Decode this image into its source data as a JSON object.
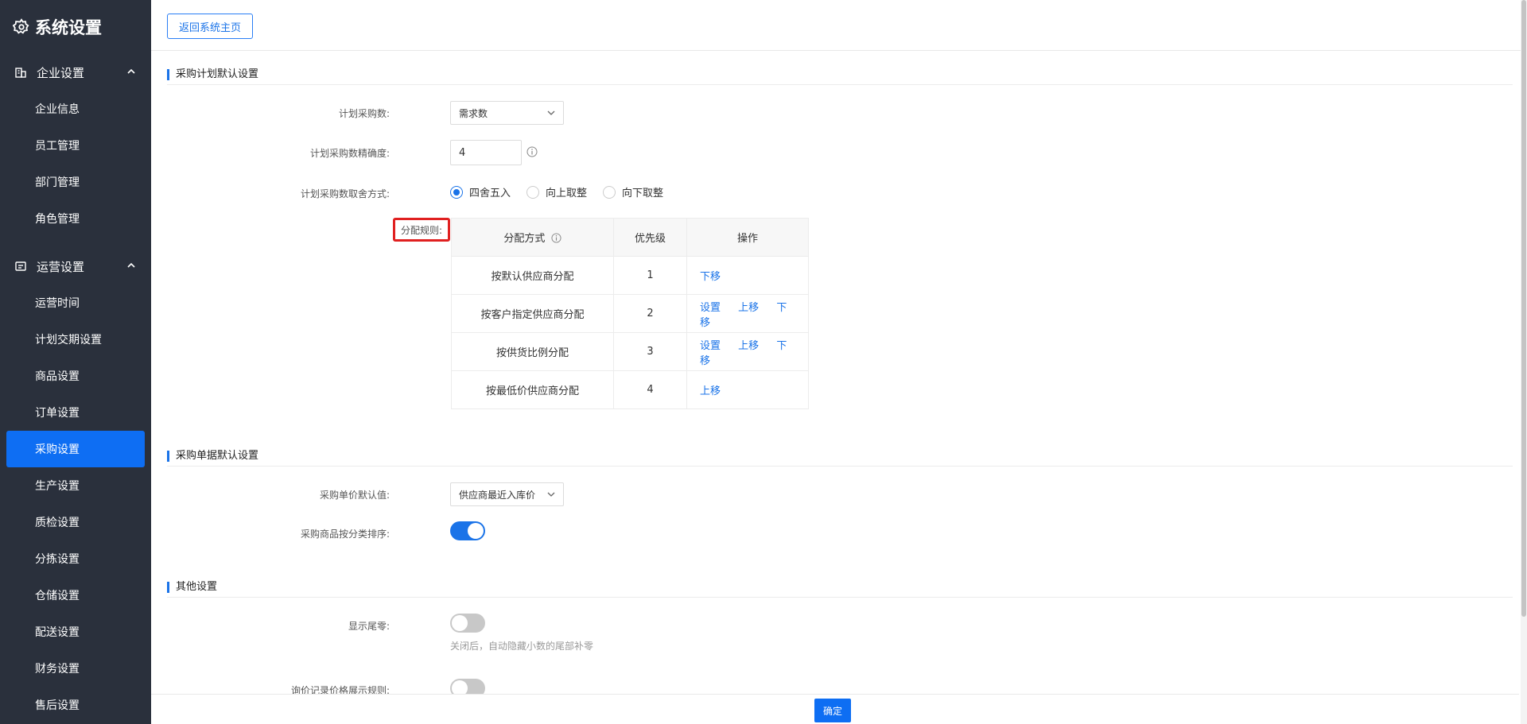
{
  "sidebar": {
    "title": "系统设置",
    "groups": [
      {
        "label": "企业设置",
        "items": [
          "企业信息",
          "员工管理",
          "部门管理",
          "角色管理"
        ]
      },
      {
        "label": "运营设置",
        "items": [
          "运营时间",
          "计划交期设置",
          "商品设置",
          "订单设置",
          "采购设置",
          "生产设置",
          "质检设置",
          "分拣设置",
          "仓储设置",
          "配送设置",
          "财务设置",
          "售后设置"
        ]
      }
    ],
    "active_item": "采购设置"
  },
  "topbar": {
    "back_label": "返回系统主页"
  },
  "section1": {
    "title": "采购计划默认设置",
    "plan_qty": {
      "label": "计划采购数:",
      "value": "需求数"
    },
    "precision": {
      "label": "计划采购数精确度:",
      "value": "4"
    },
    "rounding": {
      "label": "计划采购数取舍方式:",
      "options": [
        "四舍五入",
        "向上取整",
        "向下取整"
      ],
      "selected": "四舍五入"
    },
    "rules": {
      "label": "分配规则:",
      "headers": [
        "分配方式",
        "优先级",
        "操作"
      ],
      "rows": [
        {
          "method": "按默认供应商分配",
          "priority": "1",
          "ops": [
            "下移"
          ]
        },
        {
          "method": "按客户指定供应商分配",
          "priority": "2",
          "ops": [
            "设置",
            "上移",
            "下移"
          ]
        },
        {
          "method": "按供货比例分配",
          "priority": "3",
          "ops": [
            "设置",
            "上移",
            "下移"
          ]
        },
        {
          "method": "按最低价供应商分配",
          "priority": "4",
          "ops": [
            "上移"
          ]
        }
      ]
    }
  },
  "section2": {
    "title": "采购单据默认设置",
    "unit_price": {
      "label": "采购单价默认值:",
      "value": "供应商最近入库价"
    },
    "sort_by_category": {
      "label": "采购商品按分类排序:",
      "on": true
    }
  },
  "section3": {
    "title": "其他设置",
    "show_trailing_zero": {
      "label": "显示尾零:",
      "on": false,
      "hint": "关闭后，自动隐藏小数的尾部补零"
    },
    "inquiry_price_rule": {
      "label": "询价记录价格展示规则:",
      "on": false
    }
  },
  "footer": {
    "ok_label": "确定"
  },
  "colors": {
    "accent": "#1a73e8",
    "sidebar_bg": "#2a303c",
    "active_bg": "#0e6ef3",
    "highlight": "#e02020"
  }
}
